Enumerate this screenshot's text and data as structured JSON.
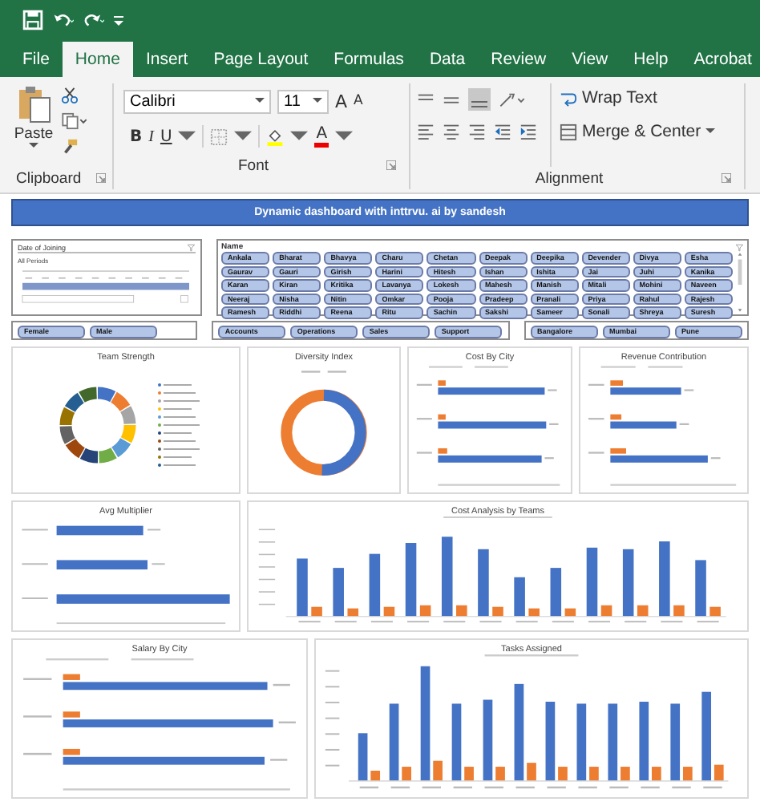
{
  "ribbon": {
    "tabs": [
      {
        "label": "File",
        "selected": false
      },
      {
        "label": "Home",
        "selected": true
      },
      {
        "label": "Insert",
        "selected": false
      },
      {
        "label": "Page Layout",
        "selected": false
      },
      {
        "label": "Formulas",
        "selected": false
      },
      {
        "label": "Data",
        "selected": false
      },
      {
        "label": "Review",
        "selected": false
      },
      {
        "label": "View",
        "selected": false
      },
      {
        "label": "Help",
        "selected": false
      },
      {
        "label": "Acrobat",
        "selected": false
      }
    ],
    "clipboard": {
      "paste": "Paste",
      "label": "Clipboard"
    },
    "font": {
      "name": "Calibri",
      "size": "11",
      "grow": "A",
      "shrink": "A",
      "bold": "B",
      "italic": "I",
      "underline": "U",
      "color_button": "A",
      "label": "Font"
    },
    "alignment": {
      "wrap_text": "Wrap Text",
      "merge": "Merge & Center",
      "label": "Alignment"
    }
  },
  "sheet": {
    "banner": "Dynamic dashboard with inttrvu. ai by sandesh",
    "date_slicer": {
      "title": "Date of Joining",
      "period": "All Periods"
    },
    "name_slicer": {
      "title": "Name",
      "items": [
        {
          "label": "Ankala",
          "selected": true
        },
        {
          "label": "Bharat",
          "selected": true
        },
        {
          "label": "Bhavya",
          "selected": true
        },
        {
          "label": "Charu",
          "selected": true
        },
        {
          "label": "Chetan",
          "selected": true
        },
        {
          "label": "Deepak",
          "selected": true
        },
        {
          "label": "Deepika",
          "selected": true
        },
        {
          "label": "Devender",
          "selected": true
        },
        {
          "label": "Divya",
          "selected": true
        },
        {
          "label": "Esha",
          "selected": true
        },
        {
          "label": "Gaurav",
          "selected": true
        },
        {
          "label": "Gauri",
          "selected": true
        },
        {
          "label": "Girish",
          "selected": true
        },
        {
          "label": "Harini",
          "selected": true
        },
        {
          "label": "Hitesh",
          "selected": true
        },
        {
          "label": "Ishan",
          "selected": true
        },
        {
          "label": "Ishita",
          "selected": true
        },
        {
          "label": "Jai",
          "selected": true
        },
        {
          "label": "Juhi",
          "selected": true
        },
        {
          "label": "Kanika",
          "selected": true
        },
        {
          "label": "Karan",
          "selected": true
        },
        {
          "label": "Kiran",
          "selected": true
        },
        {
          "label": "Kritika",
          "selected": true
        },
        {
          "label": "Lavanya",
          "selected": true
        },
        {
          "label": "Lokesh",
          "selected": true
        },
        {
          "label": "Mahesh",
          "selected": true
        },
        {
          "label": "Manish",
          "selected": true
        },
        {
          "label": "Mitali",
          "selected": true
        },
        {
          "label": "Mohini",
          "selected": true
        },
        {
          "label": "Naveen",
          "selected": true
        },
        {
          "label": "Neeraj",
          "selected": true
        },
        {
          "label": "Nisha",
          "selected": true
        },
        {
          "label": "Nitin",
          "selected": true
        },
        {
          "label": "Omkar",
          "selected": true
        },
        {
          "label": "Pooja",
          "selected": true
        },
        {
          "label": "Pradeep",
          "selected": true
        },
        {
          "label": "Pranali",
          "selected": true
        },
        {
          "label": "Priya",
          "selected": true
        },
        {
          "label": "Rahul",
          "selected": true
        },
        {
          "label": "Rajesh",
          "selected": true
        },
        {
          "label": "Ramesh",
          "selected": true
        },
        {
          "label": "Riddhi",
          "selected": true
        },
        {
          "label": "Reena",
          "selected": true
        },
        {
          "label": "Ritu",
          "selected": true
        },
        {
          "label": "Sachin",
          "selected": true
        },
        {
          "label": "Sakshi",
          "selected": true
        },
        {
          "label": "Sameer",
          "selected": true
        },
        {
          "label": "Sonali",
          "selected": true
        },
        {
          "label": "Shreya",
          "selected": true
        },
        {
          "label": "Suresh",
          "selected": true
        }
      ]
    },
    "gender_slicer": {
      "items": [
        {
          "label": "Female",
          "selected": true
        },
        {
          "label": "Male",
          "selected": true
        }
      ]
    },
    "team_slicer": {
      "items": [
        {
          "label": "Accounts",
          "selected": true
        },
        {
          "label": "Operations",
          "selected": true
        },
        {
          "label": "Sales",
          "selected": true
        },
        {
          "label": "Support",
          "selected": true
        }
      ]
    },
    "city_slicer": {
      "items": [
        {
          "label": "Bangalore",
          "selected": true
        },
        {
          "label": "Mumbai",
          "selected": true
        },
        {
          "label": "Pune",
          "selected": true
        }
      ]
    },
    "chart_rows": [
      [
        {
          "title": "Team Strength",
          "kind": "ring"
        },
        {
          "title": "Diversity Index",
          "kind": "donut"
        },
        {
          "title": "Cost By City",
          "kind": "hpair"
        },
        {
          "title": "Revenue Contribution",
          "kind": "hpair"
        }
      ],
      [
        {
          "title": "Avg Multiplier",
          "kind": "hbar"
        },
        {
          "title": "Cost Analysis by Teams",
          "kind": "vpair"
        }
      ],
      [
        {
          "title": "Salary By City",
          "kind": "hpair"
        },
        {
          "title": "Tasks Assigned",
          "kind": "vpair"
        }
      ]
    ]
  }
}
